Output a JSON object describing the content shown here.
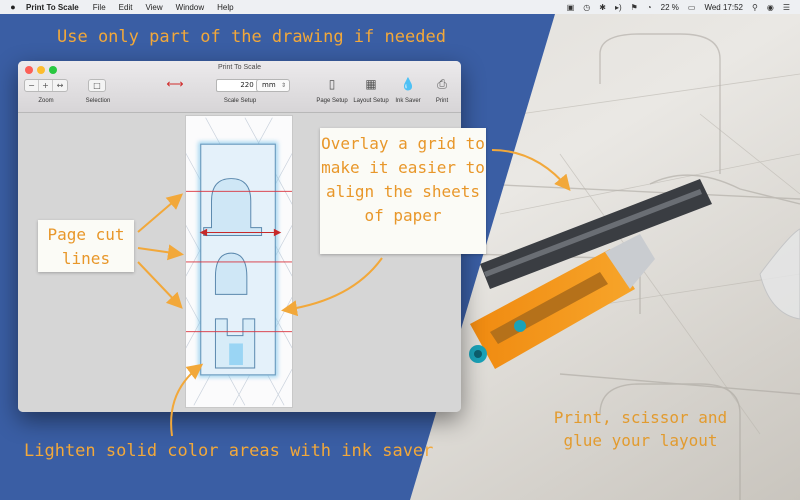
{
  "menubar": {
    "apple": "",
    "app_name": "Print To Scale",
    "menus": [
      "File",
      "Edit",
      "View",
      "Window",
      "Help"
    ],
    "battery": "22 %",
    "clock": "Wed 17:52"
  },
  "captions": {
    "top": "Use only part of the drawing if needed",
    "bottom": "Lighten solid color areas with ink saver",
    "right": "Print, scissor and glue your layout"
  },
  "callouts": {
    "cut": "Page cut lines",
    "grid": "Overlay a grid to make it easier to align the sheets of paper"
  },
  "window": {
    "title": "Print To Scale",
    "toolbar": {
      "zoom_label": "Zoom",
      "selection_label": "Selection",
      "scale_value": "220",
      "unit": "mm",
      "scale_setup_label": "Scale Setup",
      "page_setup_label": "Page Setup",
      "layout_setup_label": "Layout Setup",
      "ink_saver_label": "Ink Saver",
      "print_label": "Print"
    }
  },
  "colors": {
    "accent_orange": "#f2a83a",
    "background_blue": "#3a5ea4",
    "cut_line_red": "#d9303a"
  }
}
